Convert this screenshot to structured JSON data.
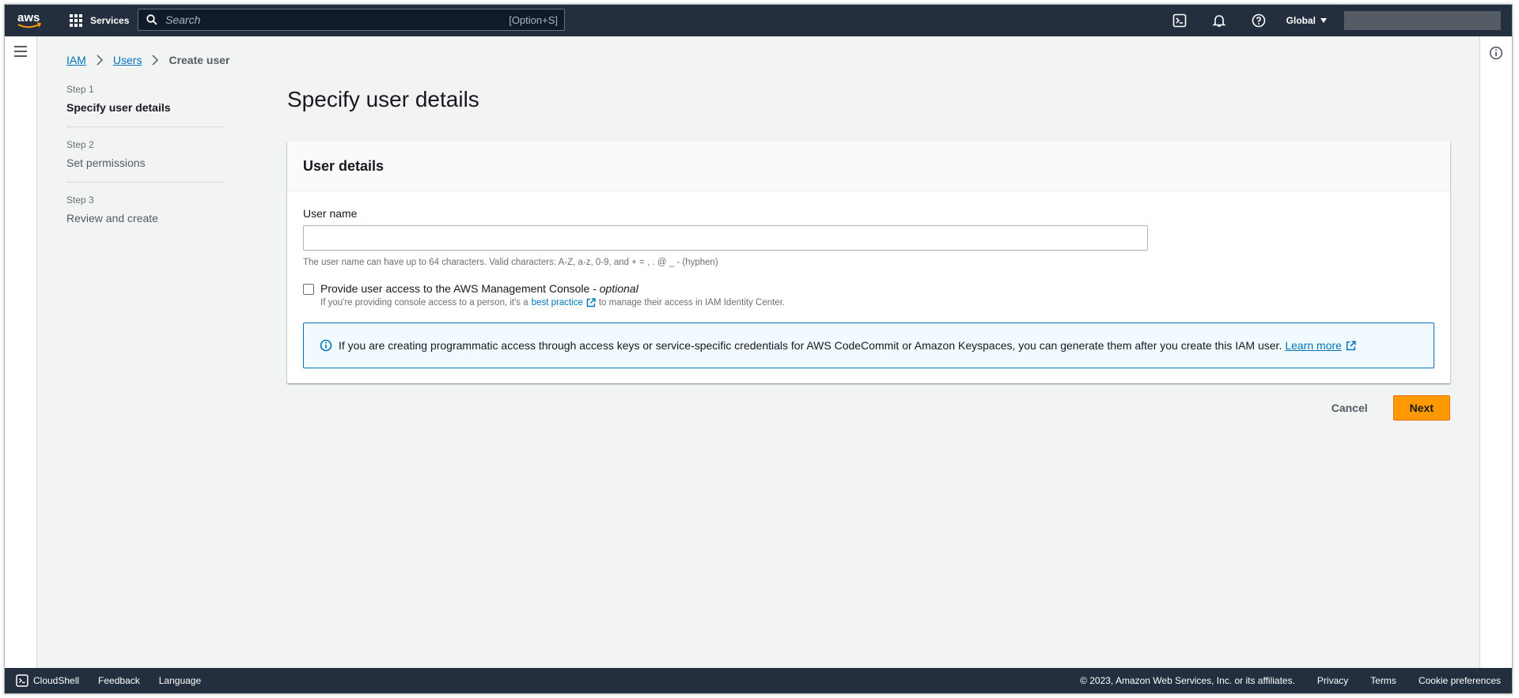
{
  "topbar": {
    "services_label": "Services",
    "search_placeholder": "Search",
    "search_shortcut": "[Option+S]",
    "region_label": "Global"
  },
  "breadcrumb": {
    "items": [
      "IAM",
      "Users"
    ],
    "current": "Create user"
  },
  "steps": [
    {
      "num": "Step 1",
      "label": "Specify user details",
      "active": true
    },
    {
      "num": "Step 2",
      "label": "Set permissions",
      "active": false
    },
    {
      "num": "Step 3",
      "label": "Review and create",
      "active": false
    }
  ],
  "page": {
    "title": "Specify user details"
  },
  "panel": {
    "title": "User details",
    "username_label": "User name",
    "username_value": "",
    "username_hint": "The user name can have up to 64 characters. Valid characters: A-Z, a-z, 0-9, and + = , . @ _ - (hyphen)",
    "console_access_label": "Provide user access to the AWS Management Console - ",
    "console_access_optional": "optional",
    "console_desc_before": "If you're providing console access to a person, it's a",
    "console_desc_link": "best practice",
    "console_desc_after": "to manage their access in IAM Identity Center.",
    "alert_text": "If you are creating programmatic access through access keys or service-specific credentials for AWS CodeCommit or Amazon Keyspaces, you can generate them after you create this IAM user.",
    "alert_link": "Learn more"
  },
  "actions": {
    "cancel_label": "Cancel",
    "next_label": "Next"
  },
  "footer": {
    "cloudshell": "CloudShell",
    "feedback": "Feedback",
    "language": "Language",
    "copyright": "© 2023, Amazon Web Services, Inc. or its affiliates.",
    "privacy": "Privacy",
    "terms": "Terms",
    "cookie": "Cookie preferences"
  },
  "colors": {
    "topbar_bg": "#232f3e",
    "primary_button": "#ff9900",
    "link": "#0073bb",
    "page_bg": "#f2f3f3"
  }
}
